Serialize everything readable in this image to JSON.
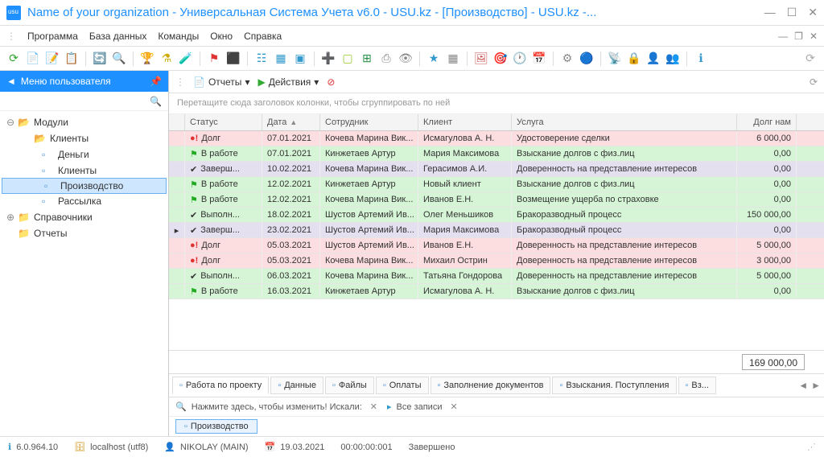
{
  "title": "Name of your organization - Универсальная Система Учета v6.0 - USU.kz - [Производство] - USU.kz -...",
  "menu": {
    "items": [
      "Программа",
      "База данных",
      "Команды",
      "Окно",
      "Справка"
    ]
  },
  "sidebar": {
    "title": "Меню пользователя",
    "nodes": {
      "modules": "Модули",
      "clients": "Клиенты",
      "money": "Деньги",
      "clients2": "Клиенты",
      "production": "Производство",
      "mail": "Рассылка",
      "ref": "Справочники",
      "reports": "Отчеты"
    }
  },
  "actions": {
    "reports": "Отчеты",
    "do": "Действия"
  },
  "group_hint": "Перетащите сюда заголовок колонки, чтобы сгруппировать по ней",
  "columns": {
    "status": "Статус",
    "date": "Дата",
    "emp": "Сотрудник",
    "client": "Клиент",
    "service": "Услуга",
    "debt": "Долг нам"
  },
  "rows": [
    {
      "cls": "row-red",
      "icon": "warn",
      "status": "Долг",
      "date": "07.01.2021",
      "emp": "Кочева Марина Вик...",
      "client": "Исмагулова А. Н.",
      "service": "Удостоверение сделки",
      "debt": "6 000,00"
    },
    {
      "cls": "row-green",
      "icon": "flag",
      "status": "В работе",
      "date": "07.01.2021",
      "emp": "Кинжетаев Артур",
      "client": "Мария Максимова",
      "service": "Взыскание долгов с физ.лиц",
      "debt": "0,00"
    },
    {
      "cls": "row-violet",
      "icon": "check",
      "status": "Заверш...",
      "date": "10.02.2021",
      "emp": "Кочева Марина Вик...",
      "client": "Герасимов А.И.",
      "service": "Доверенность на представление интересов",
      "debt": "0,00"
    },
    {
      "cls": "row-green",
      "icon": "flag",
      "status": "В работе",
      "date": "12.02.2021",
      "emp": "Кинжетаев Артур",
      "client": "Новый клиент",
      "service": "Взыскание долгов с физ.лиц",
      "debt": "0,00"
    },
    {
      "cls": "row-green",
      "icon": "flag",
      "status": "В работе",
      "date": "12.02.2021",
      "emp": "Кочева Марина Вик...",
      "client": "Иванов Е.Н.",
      "service": "Возмещение ущерба по страховке",
      "debt": "0,00"
    },
    {
      "cls": "row-green",
      "icon": "check",
      "status": "Выполн...",
      "date": "18.02.2021",
      "emp": "Шустов Артемий Ив...",
      "client": "Олег Меньшиков",
      "service": "Бракоразводный процесс",
      "debt": "150 000,00"
    },
    {
      "cls": "row-violet",
      "icon": "check",
      "status": "Заверш...",
      "date": "23.02.2021",
      "emp": "Шустов Артемий Ив...",
      "client": "Мария Максимова",
      "service": "Бракоразводный процесс",
      "debt": "0,00",
      "cur": true
    },
    {
      "cls": "row-red",
      "icon": "warn",
      "status": "Долг",
      "date": "05.03.2021",
      "emp": "Шустов Артемий Ив...",
      "client": "Иванов Е.Н.",
      "service": "Доверенность на представление интересов",
      "debt": "5 000,00"
    },
    {
      "cls": "row-red",
      "icon": "warn",
      "status": "Долг",
      "date": "05.03.2021",
      "emp": "Кочева Марина Вик...",
      "client": "Михаил Острин",
      "service": "Доверенность на представление интересов",
      "debt": "3 000,00"
    },
    {
      "cls": "row-green",
      "icon": "check",
      "status": "Выполн...",
      "date": "06.03.2021",
      "emp": "Кочева Марина Вик...",
      "client": "Татьяна Гондорова",
      "service": "Доверенность на представление интересов",
      "debt": "5 000,00"
    },
    {
      "cls": "row-green",
      "icon": "flag",
      "status": "В работе",
      "date": "16.03.2021",
      "emp": "Кинжетаев Артур",
      "client": "Исмагулова А. Н.",
      "service": "Взыскание долгов с физ.лиц",
      "debt": "0,00"
    }
  ],
  "sum": "169 000,00",
  "tabs": [
    "Работа по проекту",
    "Данные",
    "Файлы",
    "Оплаты",
    "Заполнение документов",
    "Взыскания. Поступления",
    "Вз..."
  ],
  "filter": {
    "hint": "Нажмите здесь, чтобы изменить! Искали:",
    "all": "Все записи"
  },
  "wintab": "Производство",
  "status": {
    "ver": "6.0.964.10",
    "host": "localhost (utf8)",
    "user": "NIKOLAY (MAIN)",
    "date": "19.03.2021",
    "time": "00:00:00:001",
    "state": "Завершено"
  }
}
